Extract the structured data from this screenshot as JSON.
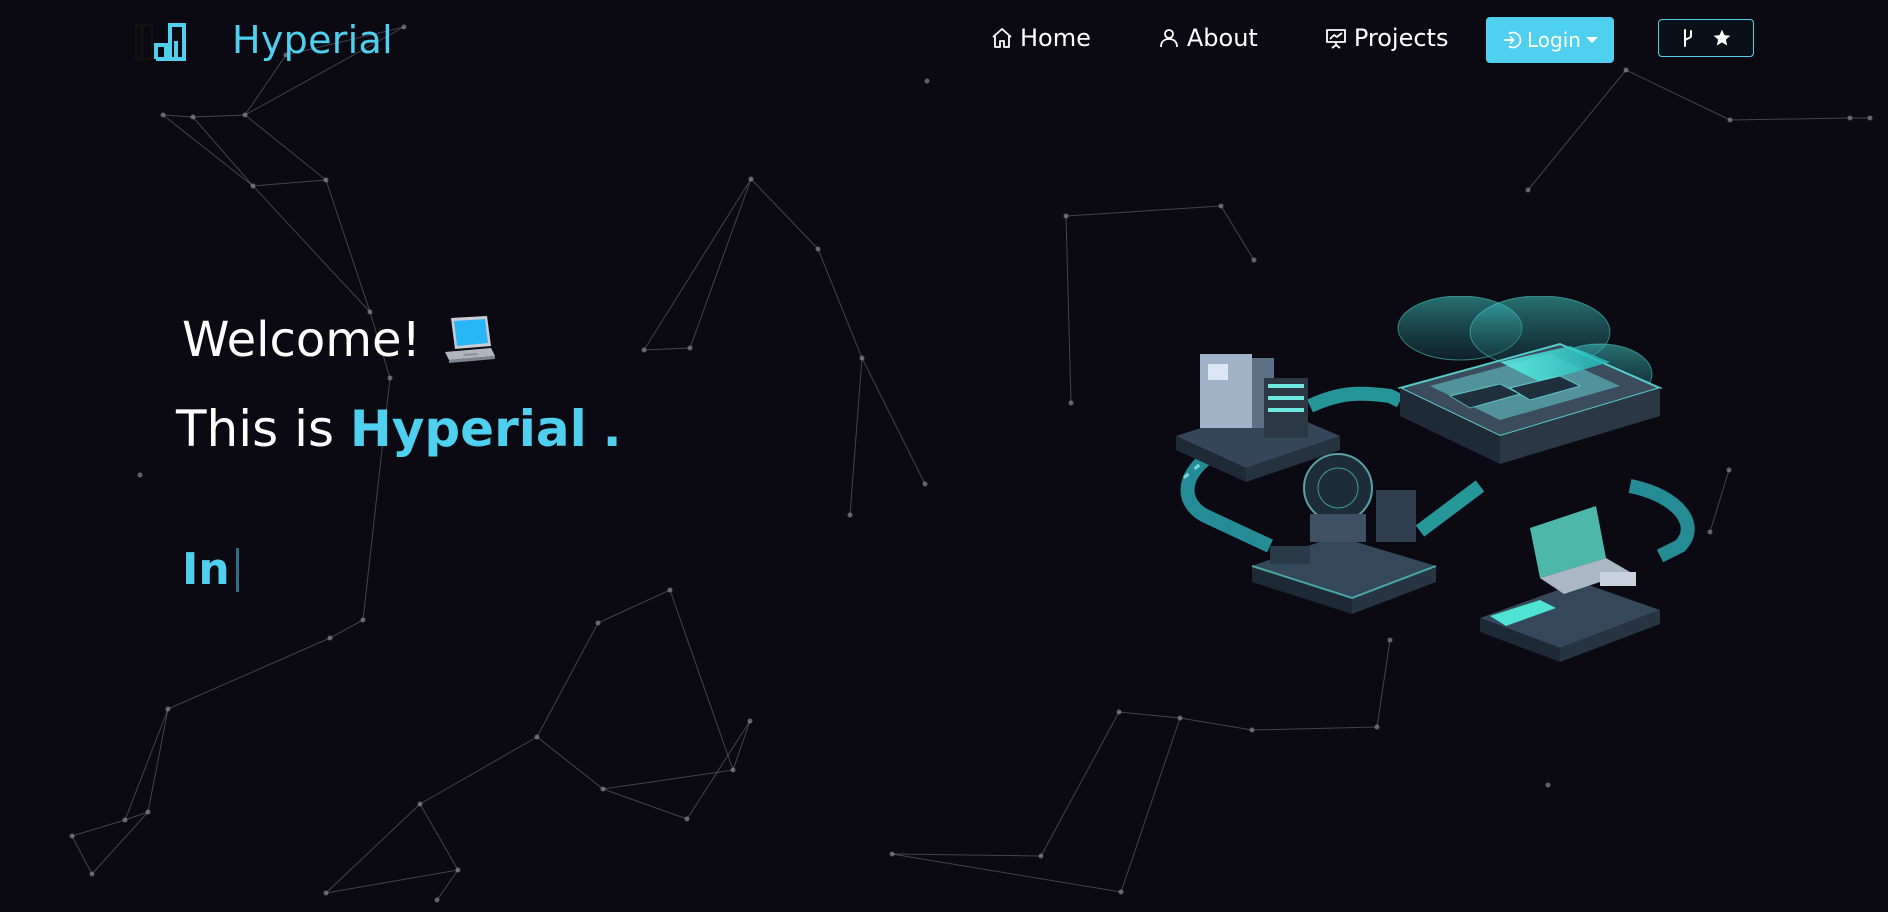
{
  "brand": {
    "name": "Hyperial",
    "logo_icon": "building-chart-icon"
  },
  "nav": {
    "items": [
      {
        "label": "Home",
        "icon": "home-icon"
      },
      {
        "label": "About",
        "icon": "user-icon"
      },
      {
        "label": "Projects",
        "icon": "presentation-icon"
      }
    ],
    "login": {
      "label": "Login",
      "icon": "login-icon"
    },
    "repo_icons": [
      "git-fork-icon",
      "star-icon"
    ]
  },
  "hero": {
    "welcome": "Welcome!",
    "welcome_emoji": "laptop-icon",
    "intro_prefix": "This is",
    "intro_name": "Hyperial",
    "intro_suffix": ".",
    "typed_text": "In"
  },
  "colors": {
    "background": "#0b0a12",
    "accent": "#4fd0ee",
    "text": "#ffffff"
  }
}
